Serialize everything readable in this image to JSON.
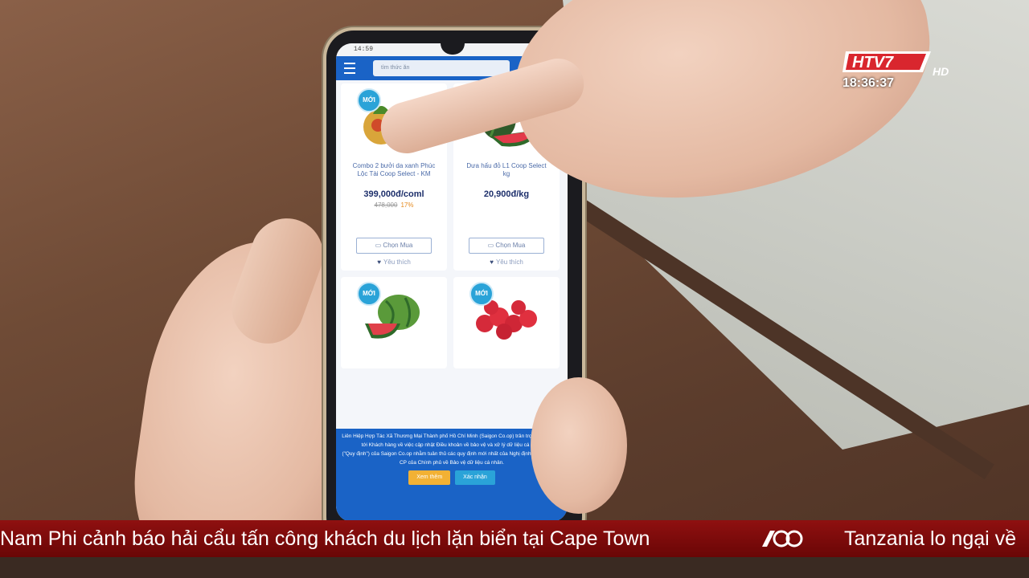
{
  "phone": {
    "status_time": "14:59",
    "search_placeholder": "tìm thức ăn",
    "products": [
      {
        "badge": "MỚI",
        "name": "Combo 2 bưởi da xanh Phúc Lộc Tài Coop Select - KM",
        "price": "399,000đ/coml",
        "old_price": "478,000",
        "discount": "17%",
        "buy_label": "Chọn Mua",
        "fav_label": "Yêu thích"
      },
      {
        "badge": "",
        "name": "Dưa hấu đỏ L1 Coop Select kg",
        "price": "20,900đ/kg",
        "buy_label": "Chọn Mua",
        "fav_label": "Yêu thích"
      },
      {
        "badge": "MỚI"
      },
      {
        "badge": "MỚI"
      }
    ],
    "notice": {
      "text1": "Liên Hiệp Hợp Tác Xã Thương Mại Thành phố Hồ Chí Minh (Saigon Co.op) trân trọng thông báo tới Khách hàng về việc cập nhật Điều khoản về bảo vệ và xử lý dữ liệu cá nhân",
      "text2": "(\"Quy định\") của Saigon Co.op nhằm tuân thủ các quy định mới nhất của Nghị định 13/2023/NĐ-CP của Chính phủ về Bảo vệ dữ liệu cá nhân.",
      "btn_more": "Xem thêm",
      "btn_ok": "Xác nhận"
    }
  },
  "broadcast": {
    "channel": "HTV7",
    "hd": "HD",
    "time": "18:36:37",
    "ticker_left": "Nam Phi cảnh báo hải cẩu tấn công khách du lịch lặn biển tại Cape Town",
    "ticker_right": "Tanzania lo ngại về"
  },
  "colors": {
    "app_blue": "#1a63c6",
    "ticker_red": "#8f1010",
    "badge_blue": "#2aa3d8"
  }
}
